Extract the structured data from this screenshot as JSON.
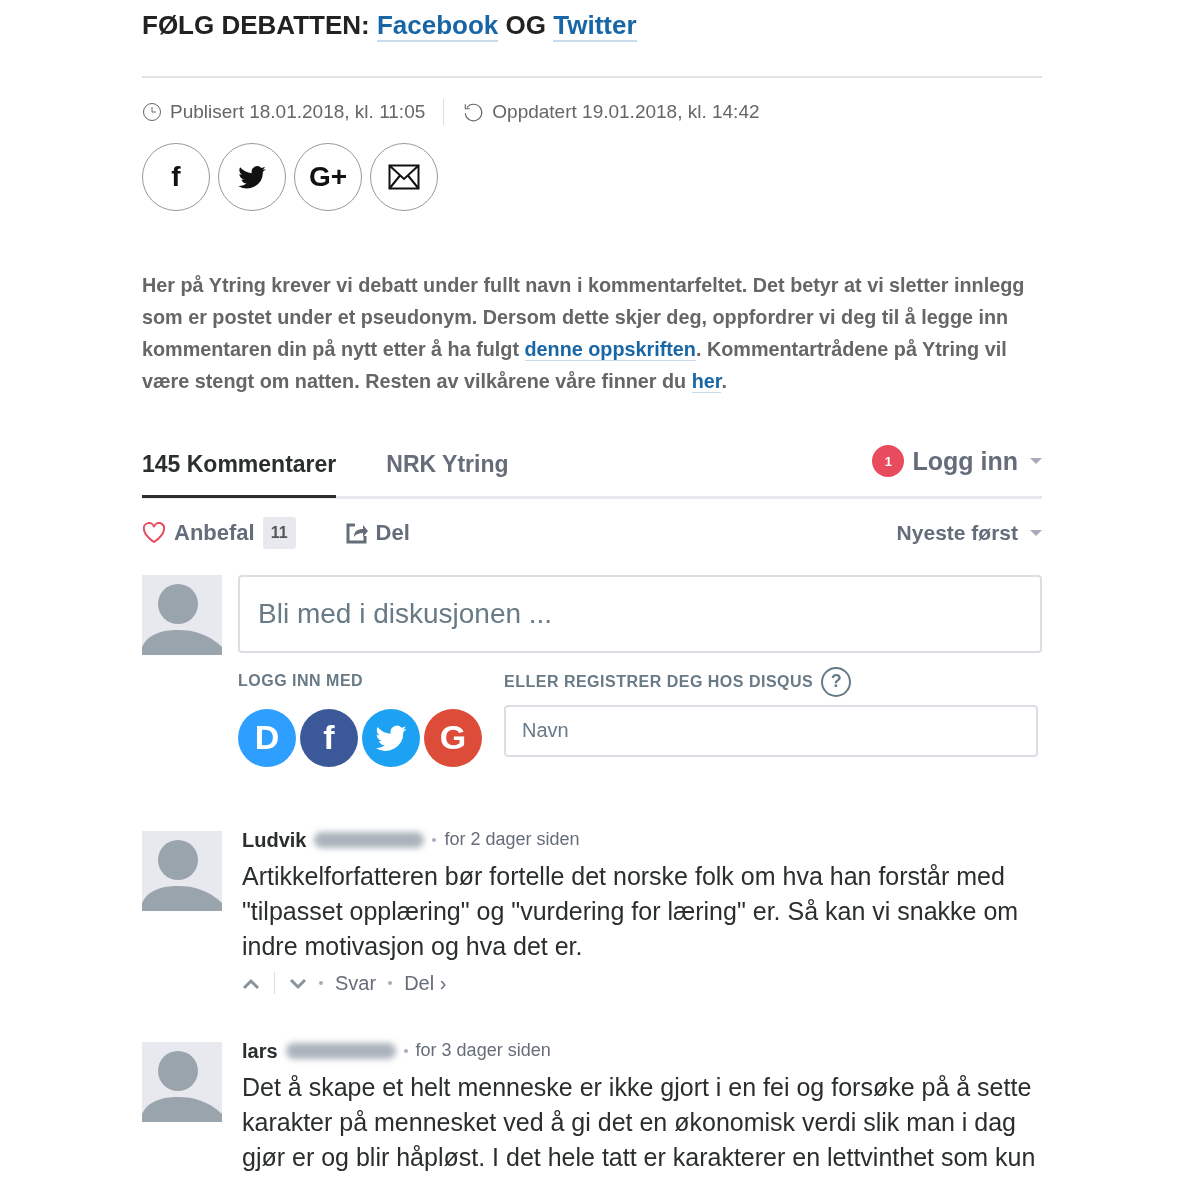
{
  "heading": [
    {
      "kind": "text",
      "text": "FØLG DEBATTEN:"
    },
    {
      "kind": "link",
      "text": "Facebook"
    },
    {
      "kind": "text",
      "text": "OG"
    },
    {
      "kind": "link",
      "text": "Twitter"
    }
  ],
  "meta": {
    "published": "Publisert 18.01.2018, kl. 11:05",
    "updated": "Oppdatert 19.01.2018, kl. 14:42"
  },
  "share_buttons": [
    {
      "kind": "letter",
      "text": "f"
    },
    {
      "kind": "bird"
    },
    {
      "kind": "letter",
      "text": "G+"
    },
    {
      "kind": "mail"
    }
  ],
  "notice": [
    {
      "kind": "text",
      "text": "Her på Ytring krever vi debatt under fullt navn i kommentarfeltet. Det betyr at vi sletter innlegg som er postet under et pseudonym. Dersom dette skjer deg, oppfordrer vi deg til å legge inn kommentaren din på nytt etter å ha fulgt"
    },
    {
      "kind": "link",
      "text": "denne oppskriften"
    },
    {
      "kind": "text",
      "text": ". Kommentartrådene på Ytring vil være stengt om natten. Resten av vilkårene våre finner du"
    },
    {
      "kind": "link",
      "text": "her"
    },
    {
      "kind": "text",
      "text": "."
    }
  ],
  "tabs": [
    {
      "label": "145 Kommentarer",
      "selected": true
    },
    {
      "label": "NRK Ytring",
      "selected": false
    }
  ],
  "login": {
    "badge": "1",
    "label": "Logg inn"
  },
  "recommend": {
    "label": "Anbefal",
    "count": "11"
  },
  "share_label": "Del",
  "sort": "Nyeste først",
  "compose": {
    "placeholder": "Bli med i diskusjonen ...",
    "login_with": "LOGG INN MED",
    "register": "ELLER REGISTRER DEG HOS DISQUS",
    "help": "?",
    "name_placeholder": "Navn"
  },
  "login_providers": [
    {
      "kind": "letter",
      "text": "D",
      "color": "#2e9fff"
    },
    {
      "kind": "letter",
      "text": "f",
      "color": "#3b5998"
    },
    {
      "kind": "bird",
      "color": "#1da1f2"
    },
    {
      "kind": "letter",
      "text": "G",
      "color": "#dd4b39"
    }
  ],
  "comments": [
    {
      "author": "Ludvik",
      "name_blurred": true,
      "time": "for 2 dager siden",
      "text": "Artikkelforfatteren bør fortelle det norske folk om hva han forstår med \"tilpasset opplæring\" og \"vurdering for læring\" er. Så kan vi snakke om indre motivasjon og hva det er.",
      "actions": [
        "Svar",
        "Del ›"
      ]
    },
    {
      "author": "lars",
      "name_blurred": true,
      "time": "for 3 dager siden",
      "text": "Det å skape et helt menneske er ikke gjort i en fei og forsøke på å sette karakter på mennesket ved å gi det en økonomisk verdi slik man i dag gjør er og blir håpløst. I det hele tatt er karakterer en lettvinthet som kun"
    }
  ]
}
